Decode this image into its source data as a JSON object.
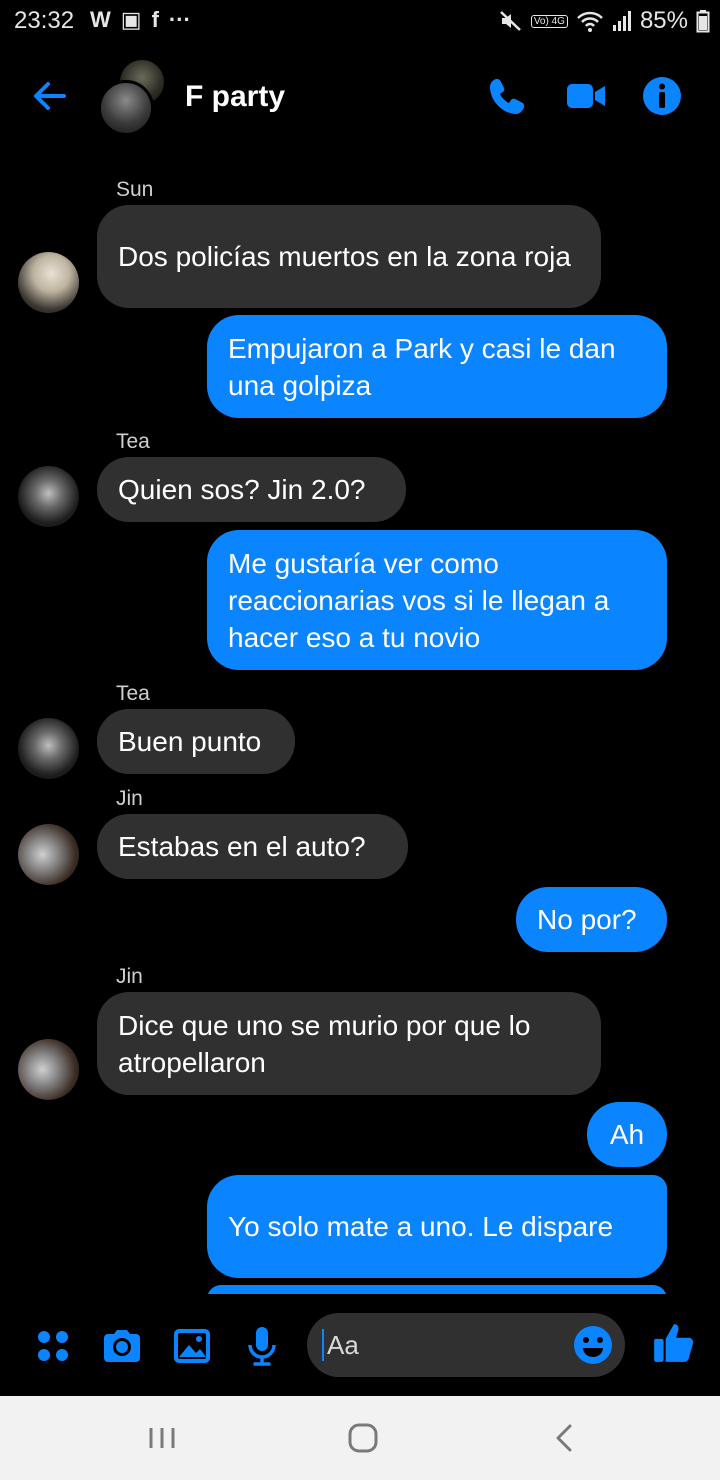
{
  "status_bar": {
    "time": "23:32",
    "left_icons": [
      "w-app-icon",
      "gallery-icon",
      "facebook-icon",
      "more-dots-icon"
    ],
    "left_glyphs": [
      "W",
      "▣",
      "f",
      "···"
    ],
    "volte_label": "Vo) 4G",
    "battery": "85%"
  },
  "header": {
    "title": "F party"
  },
  "messages": [
    {
      "sender": "Sun",
      "text": "Dos policías muertos en la zona roja",
      "direction": "incoming"
    },
    {
      "text": "Empujaron a Park y casi le dan una golpiza",
      "direction": "outgoing"
    },
    {
      "sender": "Tea",
      "text": "Quien sos? Jin 2.0?",
      "direction": "incoming"
    },
    {
      "text": "Me gustaría ver como reaccionarias vos si le llegan a hacer eso a tu novio",
      "direction": "outgoing"
    },
    {
      "sender": "Tea",
      "text": "Buen punto",
      "direction": "incoming"
    },
    {
      "sender": "Jin",
      "text": "Estabas en el auto?",
      "direction": "incoming"
    },
    {
      "text": "No por?",
      "direction": "outgoing"
    },
    {
      "sender": "Jin",
      "text": "Dice que uno se murio por que lo atropellaron",
      "direction": "incoming"
    },
    {
      "text": "Ah",
      "direction": "outgoing"
    },
    {
      "text": "Yo solo mate a uno. Le dispare",
      "direction": "outgoing"
    }
  ],
  "composer": {
    "placeholder": "Aa"
  },
  "colors": {
    "accent": "#0a84ff",
    "incoming_bubble": "#303030",
    "background": "#000000"
  }
}
